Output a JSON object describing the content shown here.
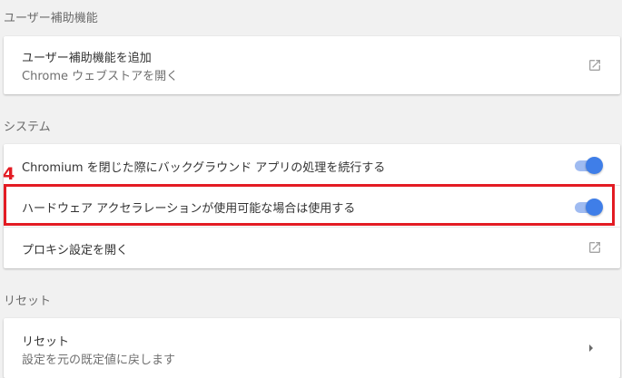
{
  "sections": {
    "accessibility": {
      "title": "ユーザー補助機能",
      "add_accessibility": {
        "title": "ユーザー補助機能を追加",
        "subtitle": "Chrome ウェブストアを開く",
        "icon": "external-link-icon"
      }
    },
    "system": {
      "title": "システム",
      "background_apps": {
        "label": "Chromium を閉じた際にバックグラウンド アプリの処理を続行する",
        "enabled": true
      },
      "hardware_acceleration": {
        "label": "ハードウェア アクセラレーションが使用可能な場合は使用する",
        "enabled": true
      },
      "proxy": {
        "label": "プロキシ設定を開く",
        "icon": "external-link-icon"
      }
    },
    "reset": {
      "title": "リセット",
      "reset_item": {
        "title": "リセット",
        "subtitle": "設定を元の既定値に戻します",
        "icon": "chevron-right-icon"
      }
    }
  },
  "annotation": {
    "step_number": "4",
    "color": "#e31b23"
  },
  "colors": {
    "toggle_on_knob": "#3f7ee8",
    "toggle_on_track": "#9fbbf1",
    "background": "#f1f1f1"
  }
}
